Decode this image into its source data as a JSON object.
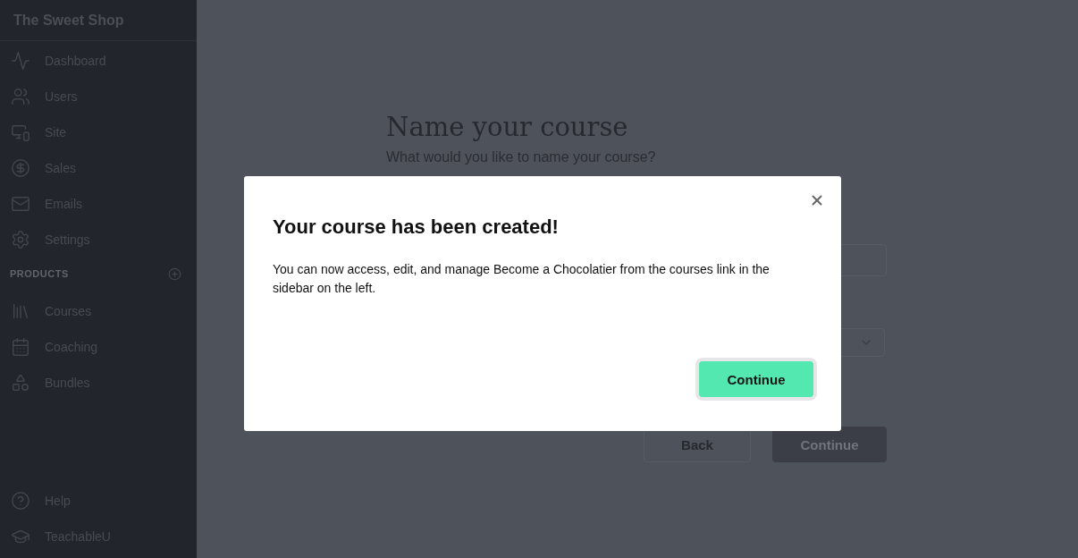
{
  "sidebar": {
    "brand": "The Sweet Shop",
    "items": [
      {
        "label": "Dashboard"
      },
      {
        "label": "Users"
      },
      {
        "label": "Site"
      },
      {
        "label": "Sales"
      },
      {
        "label": "Emails"
      },
      {
        "label": "Settings"
      }
    ],
    "section": {
      "title": "PRODUCTS",
      "items": [
        {
          "label": "Courses"
        },
        {
          "label": "Coaching"
        },
        {
          "label": "Bundles"
        }
      ]
    },
    "footer": [
      {
        "label": "Help"
      },
      {
        "label": "TeachableU"
      }
    ]
  },
  "form": {
    "title": "Name your course",
    "subtitle": "What would you like to name your course?",
    "buttons": [
      {
        "label": "Back",
        "kind": "secondary"
      },
      {
        "label": "Continue",
        "kind": "primary"
      }
    ]
  },
  "modal": {
    "title": "Your course has been created!",
    "body": "You can now access, edit, and manage Become a Chocolatier from the courses link in the sidebar on the left.",
    "button": "Continue"
  }
}
